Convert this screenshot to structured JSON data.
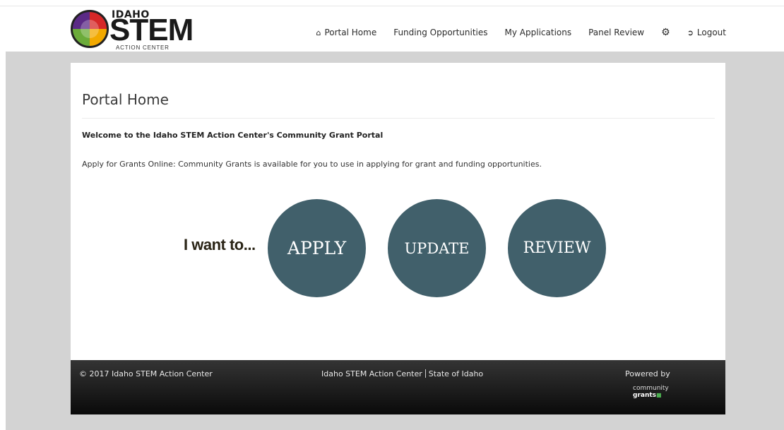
{
  "header": {
    "logo": {
      "top_text": "IDAHO",
      "main_text": "STEM",
      "sub_text": "ACTION CENTER"
    },
    "nav": [
      {
        "label": "Portal Home",
        "icon": "home-icon"
      },
      {
        "label": "Funding Opportunities"
      },
      {
        "label": "My Applications"
      },
      {
        "label": "Panel Review"
      },
      {
        "label": "",
        "icon": "gear-icon"
      },
      {
        "label": "Logout",
        "icon": "logout-icon"
      }
    ]
  },
  "main": {
    "title": "Portal Home",
    "welcome": "Welcome to the Idaho STEM Action Center's Community Grant Portal",
    "intro": "Apply for Grants Online: Community Grants is available for you to use in applying for grant and funding opportunities.",
    "i_want_to": "I want to...",
    "actions": {
      "apply": "APPLY",
      "update": "UPDATE",
      "review": "REVIEW"
    }
  },
  "footer": {
    "copyright": "© 2017 Idaho STEM Action Center",
    "link_center": "Idaho STEM Action Center",
    "link_state": "State of Idaho",
    "powered_by": "Powered by",
    "brand_line1": "community",
    "brand_line2": "grants"
  },
  "colors": {
    "action_circle": "#41606b",
    "page_background": "#d3d3d3",
    "footer_dark": "#0a0a0a"
  }
}
